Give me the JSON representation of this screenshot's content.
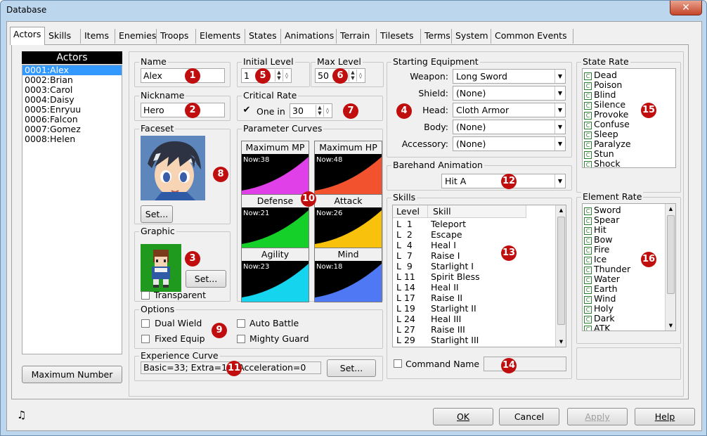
{
  "window": {
    "title": "Database",
    "close_label": "✕"
  },
  "tabs": [
    "Actors",
    "Skills",
    "Items",
    "Enemies",
    "Troops",
    "Elements",
    "States",
    "Animations",
    "Terrain",
    "Tilesets",
    "Terms",
    "System",
    "Common Events"
  ],
  "actors": {
    "header": "Actors",
    "items": [
      "0001:Alex",
      "0002:Brian",
      "0003:Carol",
      "0004:Daisy",
      "0005:Enryuu",
      "0006:Falcon",
      "0007:Gomez",
      "0008:Helen"
    ],
    "max_button": "Maximum Number"
  },
  "name": {
    "label": "Name",
    "value": "Alex"
  },
  "nickname": {
    "label": "Nickname",
    "value": "Hero"
  },
  "initial_level": {
    "label": "Initial Level",
    "value": "1"
  },
  "max_level": {
    "label": "Max Level",
    "value": "50"
  },
  "critical_rate": {
    "label": "Critical Rate",
    "check_label": "One in",
    "value": "30",
    "checked": true
  },
  "faceset": {
    "label": "Faceset",
    "set_label": "Set..."
  },
  "graphic": {
    "label": "Graphic",
    "set_label": "Set...",
    "transparent_label": "Transparent"
  },
  "param_curves": {
    "label": "Parameter Curves",
    "curves": [
      {
        "name": "Maximum MP",
        "now": "Now:38",
        "color": "#e040e8"
      },
      {
        "name": "Maximum HP",
        "now": "Now:48",
        "color": "#f2522e"
      },
      {
        "name": "Defense",
        "now": "Now:21",
        "color": "#16d02a"
      },
      {
        "name": "Attack",
        "now": "Now:26",
        "color": "#f8c20c"
      },
      {
        "name": "Agility",
        "now": "Now:23",
        "color": "#14d4ee"
      },
      {
        "name": "Mind",
        "now": "Now:18",
        "color": "#4e78f4"
      }
    ]
  },
  "options": {
    "label": "Options",
    "dual_wield": "Dual Wield",
    "fixed_equip": "Fixed Equip",
    "auto_battle": "Auto Battle",
    "mighty_guard": "Mighty Guard"
  },
  "experience": {
    "label": "Experience Curve",
    "value": "Basic=33; Extra=11; Acceleration=0",
    "set_label": "Set..."
  },
  "equipment": {
    "label": "Starting Equipment",
    "slots": [
      {
        "label": "Weapon:",
        "value": "Long Sword"
      },
      {
        "label": "Shield:",
        "value": "(None)"
      },
      {
        "label": "Head:",
        "value": "Cloth Armor"
      },
      {
        "label": "Body:",
        "value": "(None)"
      },
      {
        "label": "Accessory:",
        "value": "(None)"
      }
    ]
  },
  "barehand": {
    "label": "Barehand Animation",
    "value": "Hit A"
  },
  "skills": {
    "label": "Skills",
    "col_level": "Level",
    "col_skill": "Skill",
    "rows": [
      {
        "level": "L  1",
        "skill": "Teleport"
      },
      {
        "level": "L  2",
        "skill": "Escape"
      },
      {
        "level": "L  4",
        "skill": "Heal I"
      },
      {
        "level": "L  7",
        "skill": "Raise I"
      },
      {
        "level": "L  9",
        "skill": "Starlight I"
      },
      {
        "level": "L 11",
        "skill": "Spirit Bless"
      },
      {
        "level": "L 14",
        "skill": "Heal II"
      },
      {
        "level": "L 17",
        "skill": "Raise II"
      },
      {
        "level": "L 19",
        "skill": "Starlight II"
      },
      {
        "level": "L 24",
        "skill": "Heal III"
      },
      {
        "level": "L 27",
        "skill": "Raise III"
      },
      {
        "level": "L 29",
        "skill": "Starlight III"
      }
    ],
    "command_name_label": "Command Name"
  },
  "state_rate": {
    "label": "State Rate",
    "grade": "C",
    "items": [
      "Dead",
      "Poison",
      "Blind",
      "Silence",
      "Provoke",
      "Confuse",
      "Sleep",
      "Paralyze",
      "Stun",
      "Shock"
    ]
  },
  "element_rate": {
    "label": "Element Rate",
    "grade": "C",
    "items": [
      "Sword",
      "Spear",
      "Hit",
      "Bow",
      "Fire",
      "Ice",
      "Thunder",
      "Water",
      "Earth",
      "Wind",
      "Holy",
      "Dark",
      "ATK"
    ]
  },
  "badges": [
    "1",
    "2",
    "3",
    "4",
    "5",
    "6",
    "7",
    "8",
    "9",
    "10",
    "11",
    "12",
    "13",
    "14",
    "15",
    "16"
  ],
  "footer": {
    "ok": "OK",
    "cancel": "Cancel",
    "apply": "Apply",
    "help": "Help"
  }
}
